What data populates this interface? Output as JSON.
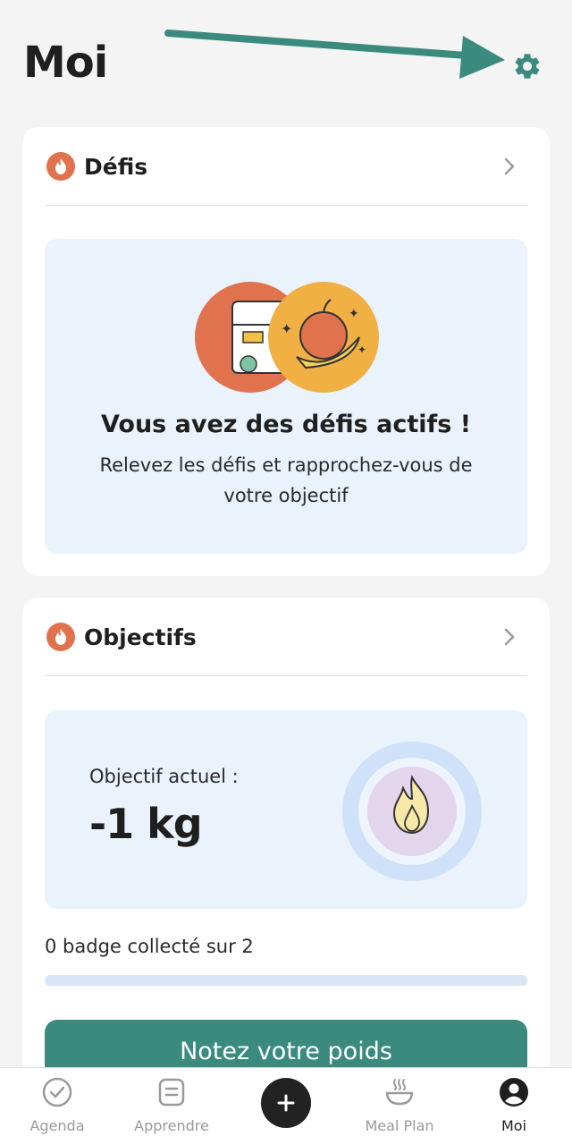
{
  "header": {
    "title": "Moi"
  },
  "defis": {
    "title": "Défis",
    "heading": "Vous avez des défis actifs !",
    "text": "Relevez les défis et rapprochez-vous de votre objectif"
  },
  "objectifs": {
    "title": "Objectifs",
    "current_label": "Objectif actuel :",
    "current_value": "-1 kg",
    "badges_text": "0 badge collecté sur 2",
    "badges_progress": 0,
    "cta_label": "Notez votre poids"
  },
  "tabbar": {
    "items": [
      {
        "label": "Agenda",
        "icon": "check-circle-icon",
        "active": false
      },
      {
        "label": "Apprendre",
        "icon": "document-icon",
        "active": false
      },
      {
        "label": "",
        "icon": "plus-icon",
        "active": false
      },
      {
        "label": "Meal Plan",
        "icon": "bowl-icon",
        "active": false
      },
      {
        "label": "Moi",
        "icon": "user-icon",
        "active": true
      }
    ]
  },
  "colors": {
    "accent": "#3a8a7d",
    "flame": "#e0734e",
    "card_tint": "#eaf2fc"
  }
}
